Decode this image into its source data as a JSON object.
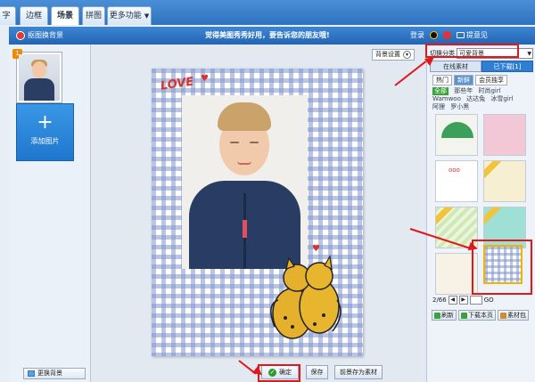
{
  "tabs": [
    {
      "label": "字",
      "active": false
    },
    {
      "label": "边框",
      "active": false
    },
    {
      "label": "场景",
      "active": true
    },
    {
      "label": "拼图",
      "active": false
    },
    {
      "label": "更多功能",
      "active": false
    }
  ],
  "titlebar": {
    "title": "抠图换背景",
    "banner": "觉得美图秀秀好用，要告诉您的朋友哦!",
    "login": "登录",
    "feedback": "提意见"
  },
  "left": {
    "thumb_badge": "1",
    "add_button": "添加图片",
    "change_bg": "更换背景"
  },
  "canvas": {
    "bg_settings": "背景设置",
    "love_text": "LOVE",
    "ok_button": "确定",
    "save_button": "保存",
    "save_material_button": "前景存为素材"
  },
  "right": {
    "category_label": "切换分类",
    "category_value": "可爱背景",
    "source_tabs": [
      {
        "label": "在线素材",
        "active": false
      },
      {
        "label": "已下载[1]",
        "active": true
      }
    ],
    "sub_tabs": [
      {
        "label": "热门",
        "active": false
      },
      {
        "label": "新鲜",
        "active": true
      },
      {
        "label": "会员独享",
        "active": false
      }
    ],
    "tags": [
      {
        "label": "全部",
        "active": true
      },
      {
        "label": "那些年",
        "active": false
      },
      {
        "label": "时尚girl",
        "active": false
      },
      {
        "label": "Wamwoo",
        "active": false
      },
      {
        "label": "达达兔",
        "active": false
      },
      {
        "label": "冰雪girl",
        "active": false
      },
      {
        "label": "阿狸",
        "active": false
      },
      {
        "label": "罗小黑",
        "active": false
      }
    ],
    "pager": {
      "page": "2/66",
      "go": "GO"
    },
    "actions": [
      {
        "label": "刷新"
      },
      {
        "label": "下载本页"
      },
      {
        "label": "素材包"
      }
    ]
  },
  "colors": {
    "accent": "#2e7fd1",
    "annotation": "#e0181c"
  }
}
